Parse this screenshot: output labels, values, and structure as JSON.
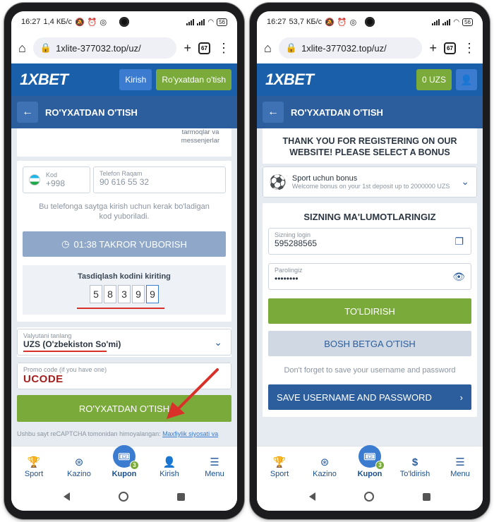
{
  "left": {
    "status": {
      "time": "16:27",
      "speed": "1,4 КБ/с",
      "battery": "56"
    },
    "browser": {
      "url": "1xlite-377032.top/uz/",
      "tabs": "67"
    },
    "header": {
      "logo": "1XBET",
      "login": "Kirish",
      "register": "Ro'yxatdan o'tish"
    },
    "subheader": {
      "title": "RO'YXATDAN O'TISH"
    },
    "social_text": "tarmoqlar va messenjerlar",
    "phone": {
      "code_label": "Kod",
      "code_value": "+998",
      "phone_label": "Telefon Raqam",
      "phone_value": "90 616 55 32"
    },
    "info_text": "Bu telefonga saytga kirish uchun kerak bo'ladigan kod yuboriladi.",
    "resend_button": "01:38 TAKROR YUBORISH",
    "verify": {
      "title": "Tasdiqlash kodini kiriting",
      "digits": [
        "5",
        "8",
        "3",
        "9",
        "9"
      ]
    },
    "currency": {
      "label": "Valyutani tanlang",
      "value": "UZS  (O'zbekiston So'mi)"
    },
    "promo": {
      "label": "Promo code (if you have one)",
      "value": "UCODE"
    },
    "submit": "RO'YXATDAN O'TISH",
    "recaptcha": {
      "text": "Ushbu sayt reCAPTCHA tomonidan himoyalangan:",
      "link": "Maxfiylik siyosati va"
    },
    "nav": {
      "sport": "Sport",
      "kazino": "Kazino",
      "kupon": "Kupon",
      "badge": "3",
      "kirish": "Kirish",
      "menu": "Menu"
    }
  },
  "right": {
    "status": {
      "time": "16:27",
      "speed": "53,7 КБ/с",
      "battery": "56"
    },
    "browser": {
      "url": "1xlite-377032.top/uz/",
      "tabs": "67"
    },
    "header": {
      "logo": "1XBET",
      "balance": "0 UZS"
    },
    "subheader": {
      "title": "RO'YXATDAN O'TISH"
    },
    "thanks": "THANK YOU FOR REGISTERING ON OUR WEBSITE! PLEASE SELECT A BONUS",
    "bonus": {
      "title": "Sport uchun bonus",
      "desc": "Welcome bonus on your 1st deposit up to 2000000 UZS"
    },
    "info_title": "SIZNING MA'LUMOTLARINGIZ",
    "login": {
      "label": "Sizning login",
      "value": "595288565"
    },
    "password": {
      "label": "Parolingiz",
      "value": "••••••••"
    },
    "fill_button": "TO'LDIRISH",
    "home_button": "BOSH BETGA O'TISH",
    "save_note": "Don't forget to save your username and password",
    "save_button": "SAVE USERNAME AND PASSWORD",
    "nav": {
      "sport": "Sport",
      "kazino": "Kazino",
      "kupon": "Kupon",
      "badge": "3",
      "deposit": "To'ldirish",
      "menu": "Menu"
    }
  },
  "colors": {
    "brand_blue": "#1a5faa",
    "accent_green": "#7aab3a",
    "arrow_red": "#d9302a"
  }
}
